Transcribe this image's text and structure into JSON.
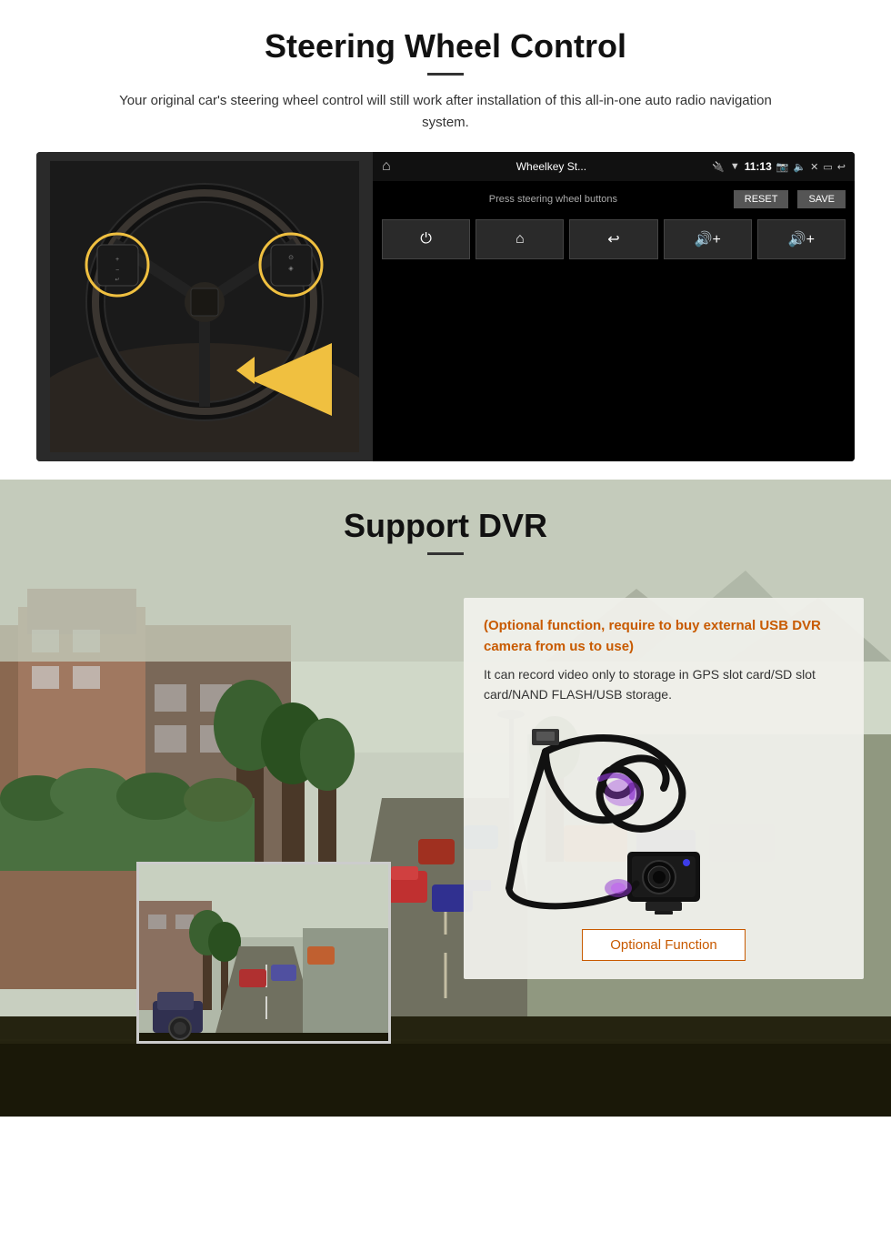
{
  "steering_section": {
    "title": "Steering Wheel Control",
    "subtitle_text": "Your original car's steering wheel control will still work after installation of this all-in-one auto radio navigation system.",
    "android_screen": {
      "app_title": "Wheelkey St...",
      "time": "11:13",
      "instruction": "Press steering wheel buttons",
      "reset_label": "RESET",
      "save_label": "SAVE",
      "buttons": [
        {
          "icon": "⏻"
        },
        {
          "icon": "⌂"
        },
        {
          "icon": "↩"
        },
        {
          "icon": "🔊+"
        },
        {
          "icon": "🔊+"
        }
      ]
    }
  },
  "dvr_section": {
    "title": "Support DVR",
    "optional_note": "(Optional function, require to buy external USB DVR camera from us to use)",
    "description": "It can record video only to storage in GPS slot card/SD slot card/NAND FLASH/USB storage.",
    "optional_function_label": "Optional Function"
  }
}
